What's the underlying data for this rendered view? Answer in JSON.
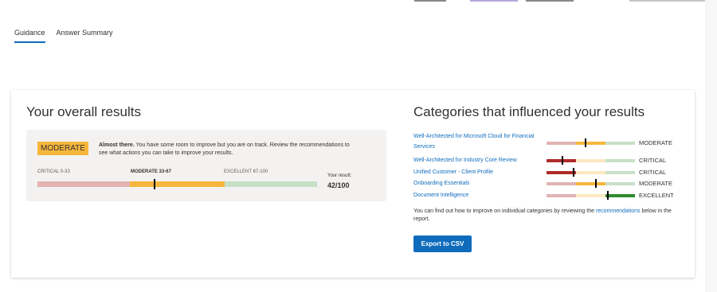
{
  "tabs": [
    {
      "label": "Guidance",
      "active": true
    },
    {
      "label": "Answer Summary",
      "active": false
    }
  ],
  "overall": {
    "title": "Your overall results",
    "badge": "MODERATE",
    "message_bold": "Almost there.",
    "message_rest": " You have some room to improve but you are on track. Review the recommendations to see what actions you can take to improve your results.",
    "scale": {
      "critical_label": "CRITICAL 0-33",
      "moderate_label": "MODERATE 33-67",
      "excellent_label": "EXCELLENT 67-100",
      "colors": {
        "critical": "#e2b3b3",
        "moderate": "#f6b73c",
        "excellent": "#c7dfc7"
      }
    },
    "your_result_label": "Your result:",
    "your_result_value": "42/100",
    "score": 42
  },
  "categories": {
    "title": "Categories that influenced your results",
    "items": [
      {
        "label": "Well-Architected for Microsoft Cloud for Financial Services",
        "status": "MODERATE",
        "score": 44,
        "colors": {
          "low": "#e2b3b3",
          "mid": "#f6b73c",
          "high": "#c7dfc7"
        }
      },
      {
        "label": "Well-Architected for Industry Core Review",
        "status": "CRITICAL",
        "score": 18,
        "colors": {
          "low": "#b02a2a",
          "mid": "#fde7c0",
          "high": "#c7dfc7"
        }
      },
      {
        "label": "Unified Customer - Client Profile",
        "status": "CRITICAL",
        "score": 31,
        "colors": {
          "low": "#b02a2a",
          "mid": "#fde7c0",
          "high": "#c7dfc7"
        }
      },
      {
        "label": "Onboarding Essentials",
        "status": "MODERATE",
        "score": 56,
        "colors": {
          "low": "#e2b3b3",
          "mid": "#f6b73c",
          "high": "#c7dfc7"
        }
      },
      {
        "label": "Document Intelligence",
        "status": "EXCELLENT",
        "score": 69,
        "colors": {
          "low": "#e2b3b3",
          "mid": "#fde7c0",
          "high": "#2e8b2e"
        }
      }
    ],
    "find_text_before": "You can find out how to improve on individual categories by reviewing the ",
    "find_link": "recommendations",
    "find_text_after": " below in the report.",
    "export_label": "Export to CSV"
  }
}
